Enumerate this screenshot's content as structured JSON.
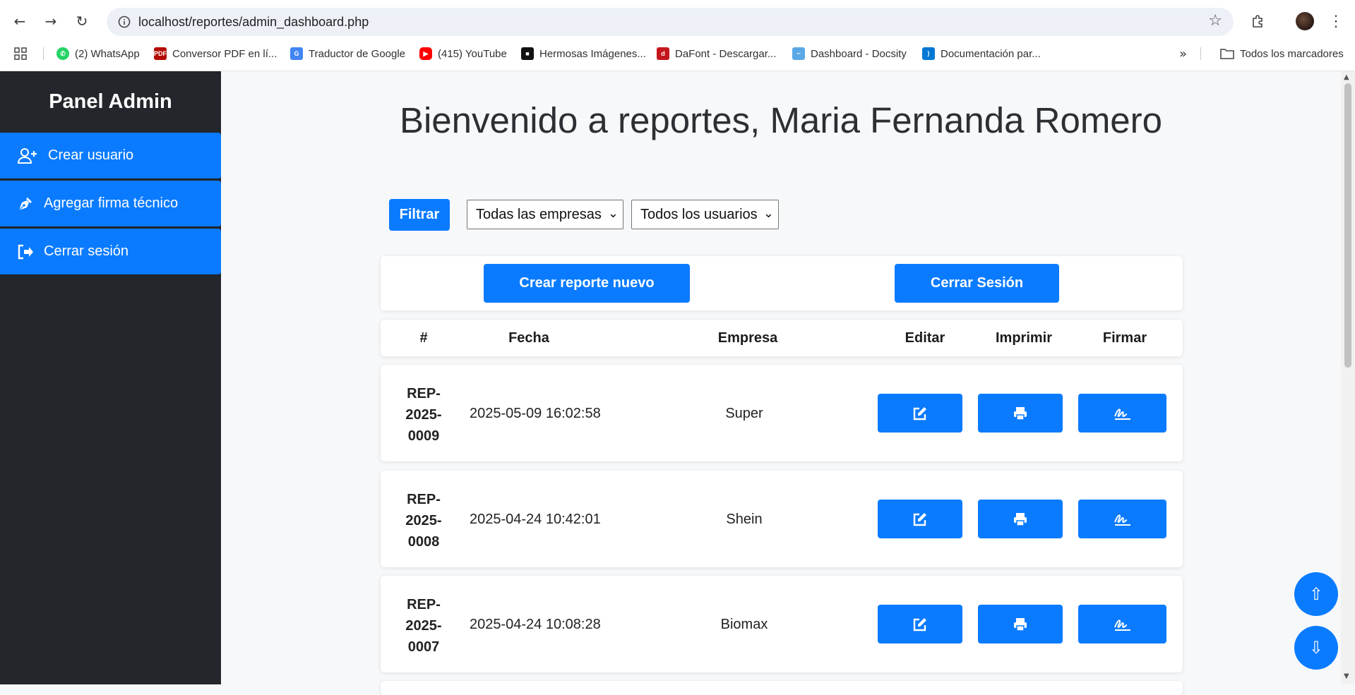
{
  "browser": {
    "url": "localhost/reportes/admin_dashboard.php",
    "bookmarks": [
      {
        "label": "(2) WhatsApp",
        "icon": "whatsapp-icon",
        "color": "#25d366"
      },
      {
        "label": "Conversor PDF en lí...",
        "icon": "pdf-icon",
        "color": "#b30b00"
      },
      {
        "label": "Traductor de Google",
        "icon": "google-translate-icon",
        "color": "#4285f4"
      },
      {
        "label": "(415) YouTube",
        "icon": "youtube-icon",
        "color": "#ff0000"
      },
      {
        "label": "Hermosas Imágenes...",
        "icon": "unsplash-icon",
        "color": "#111111"
      },
      {
        "label": "DaFont - Descargar...",
        "icon": "dafont-icon",
        "color": "#c4161c"
      },
      {
        "label": "Dashboard - Docsity",
        "icon": "docsity-icon",
        "color": "#5aa9e6"
      },
      {
        "label": "Documentación par...",
        "icon": "vscode-icon",
        "color": "#0078d4"
      }
    ],
    "all_bookmarks_label": "Todos los marcadores"
  },
  "sidebar": {
    "title": "Panel Admin",
    "items": [
      {
        "label": "Crear usuario",
        "icon": "user-plus-icon"
      },
      {
        "label": "Agregar firma técnico",
        "icon": "pen-nib-icon"
      },
      {
        "label": "Cerrar sesión",
        "icon": "sign-out-icon"
      }
    ]
  },
  "main": {
    "title": "Bienvenido a reportes, Maria Fernanda Romero",
    "filter_label": "Filtrar",
    "company_select": "Todas las empresas",
    "user_select": "Todos los usuarios",
    "create_report_label": "Crear reporte nuevo",
    "logout_label": "Cerrar Sesión",
    "table_headers": [
      "#",
      "Fecha",
      "Empresa",
      "Editar",
      "Imprimir",
      "Firmar"
    ],
    "rows": [
      {
        "id": "REP-\n2025-\n0009",
        "fecha": "2025-05-09 16:02:58",
        "empresa": "Super"
      },
      {
        "id": "REP-\n2025-\n0008",
        "fecha": "2025-04-24 10:42:01",
        "empresa": "Shein"
      },
      {
        "id": "REP-\n2025-\n0007",
        "fecha": "2025-04-24 10:08:28",
        "empresa": "Biomax"
      }
    ]
  },
  "colors": {
    "primary": "#0a7bff",
    "sidebar_bg": "#23272b"
  }
}
